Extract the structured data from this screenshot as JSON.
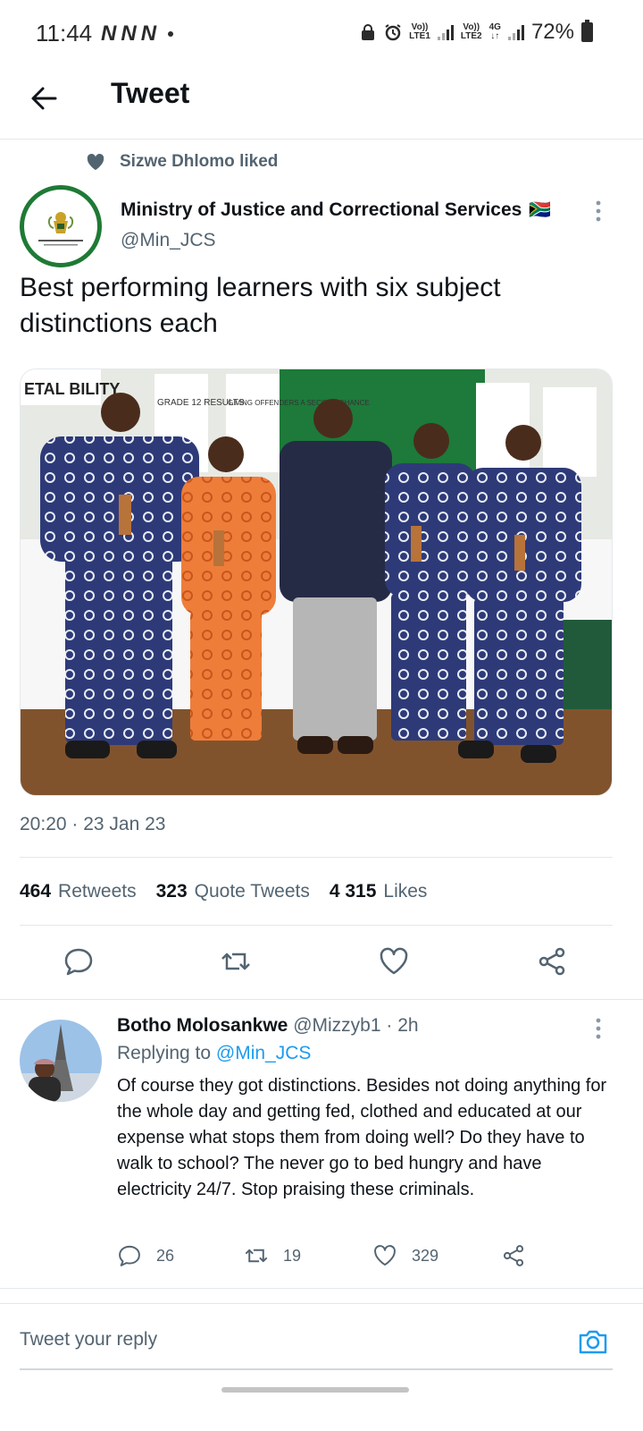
{
  "status_bar": {
    "time": "11:44",
    "notification_icons": [
      "N",
      "N",
      "N"
    ],
    "net1_top": "Vo))",
    "net1_bottom": "LTE1",
    "net2_top": "Vo))",
    "net2_bottom": "LTE2",
    "net3_top": "4G",
    "net3_bottom": "↓↑",
    "battery": "72%"
  },
  "header": {
    "title": "Tweet"
  },
  "social_context": {
    "text": "Sizwe Dhlomo liked"
  },
  "tweet": {
    "author_name": "Ministry of Justice and Correctional Services",
    "author_flag": "🇿🇦",
    "author_handle": "@Min_JCS",
    "text": "Best performing learners with six subject distinctions each",
    "timestamp": "20:20 · 23 Jan 23",
    "stats": {
      "retweets_count": "464",
      "retweets_label": "Retweets",
      "quotes_count": "323",
      "quotes_label": "Quote Tweets",
      "likes_count": "4 315",
      "likes_label": "Likes"
    },
    "photo_signs": {
      "sign1": "GRADE 12 RESULTS",
      "sign2": "GIVING OFFENDERS A SECOND CHANCE",
      "sign3": "ETAL BILITY"
    }
  },
  "reply": {
    "author_name": "Botho Molosankwe",
    "author_handle": "@Mizzyb1",
    "time": "· 2h",
    "replying_prefix": "Replying to",
    "replying_handle": "@Min_JCS",
    "text": "Of course they got distinctions. Besides not doing anything for the whole day and getting fed, clothed and educated at our expense what stops them from doing well? Do they have to walk to school? The never go to bed hungry and have electricity 24/7. Stop praising these criminals.",
    "reply_count": "26",
    "retweet_count": "19",
    "like_count": "329"
  },
  "compose": {
    "placeholder": "Tweet your reply"
  },
  "colors": {
    "accent": "#1d9bf0",
    "text_primary": "#0f1419",
    "text_secondary": "#536471",
    "divider": "#e4e8eb",
    "ministry_ring": "#1e7a34"
  }
}
